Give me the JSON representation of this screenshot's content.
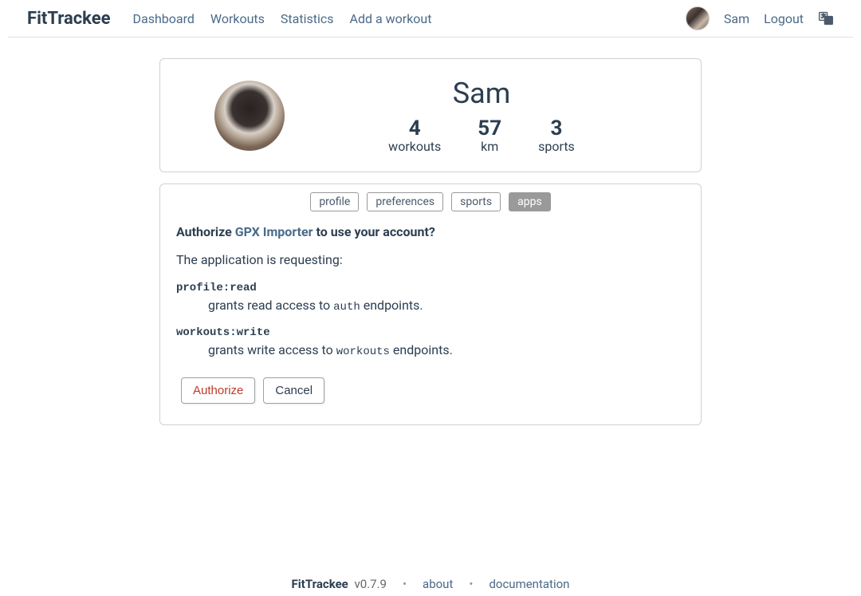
{
  "nav": {
    "brand": "FitTrackee",
    "links": [
      "Dashboard",
      "Workouts",
      "Statistics",
      "Add a workout"
    ],
    "user": "Sam",
    "logout": "Logout"
  },
  "profile": {
    "name": "Sam",
    "stats": [
      {
        "value": "4",
        "label": "workouts"
      },
      {
        "value": "57",
        "label": "km"
      },
      {
        "value": "3",
        "label": "sports"
      }
    ]
  },
  "tabs": [
    {
      "label": "profile",
      "active": false
    },
    {
      "label": "preferences",
      "active": false
    },
    {
      "label": "sports",
      "active": false
    },
    {
      "label": "apps",
      "active": true
    }
  ],
  "auth": {
    "title_prefix": "Authorize ",
    "app_name": "GPX Importer",
    "title_suffix": " to use your account?",
    "requesting_text": "The application is requesting:",
    "scopes": [
      {
        "name": "profile:read",
        "desc_prefix": "grants read access to ",
        "desc_code": "auth",
        "desc_suffix": " endpoints."
      },
      {
        "name": "workouts:write",
        "desc_prefix": "grants write access to ",
        "desc_code": "workouts",
        "desc_suffix": " endpoints."
      }
    ],
    "authorize_label": "Authorize",
    "cancel_label": "Cancel"
  },
  "footer": {
    "brand": "FitTrackee",
    "version": "v0.7.9",
    "about": "about",
    "documentation": "documentation",
    "sep": "•"
  }
}
